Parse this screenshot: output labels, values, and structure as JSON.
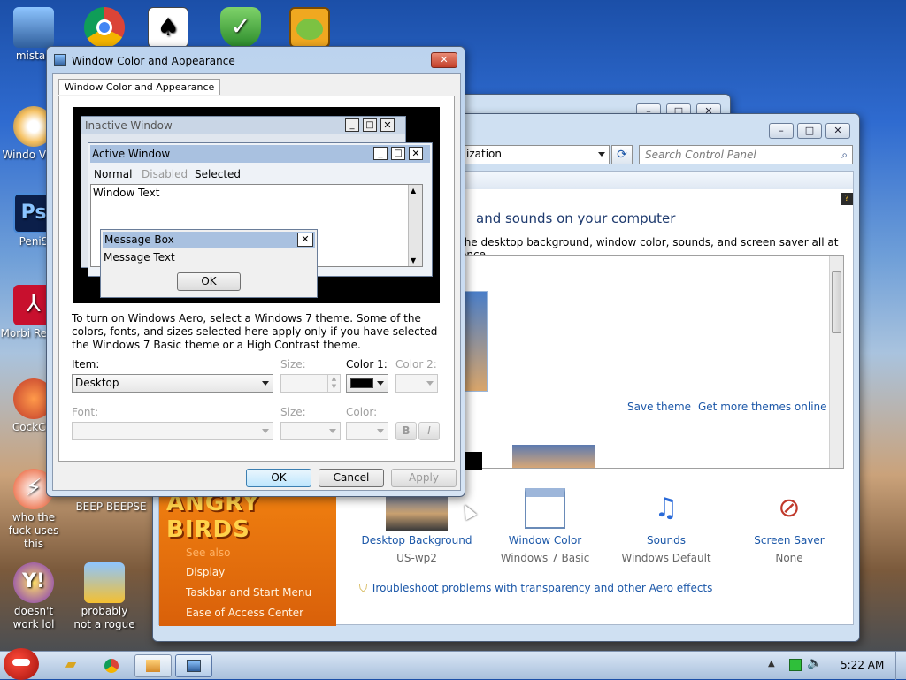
{
  "desktop": {
    "icons": [
      {
        "label": "mistak"
      },
      {
        "label": ""
      },
      {
        "label": ""
      },
      {
        "label": ""
      },
      {
        "label": ""
      },
      {
        "label": "Windo Vista"
      },
      {
        "label": "PeniS"
      },
      {
        "label": "Morbi Reade"
      },
      {
        "label": "CockCle"
      },
      {
        "label": "who the fuck uses this"
      },
      {
        "label": "BEEP BEEP"
      },
      {
        "label": "SE"
      },
      {
        "label": "doesn't work lol"
      },
      {
        "label": "probably not a rogue"
      }
    ]
  },
  "control_panel": {
    "address": "ization",
    "search_placeholder": "Search Control Panel",
    "heading": "and sounds on your computer",
    "subheading": "the desktop background, window color, sounds, and screen saver all at once.",
    "save_theme": "Save theme",
    "get_more_themes": "Get more themes online",
    "sidebar": {
      "see_also": "See also",
      "items": [
        "Display",
        "Taskbar and Start Menu",
        "Ease of Access Center"
      ]
    },
    "items": [
      {
        "title": "Desktop Background",
        "subtitle": "US-wp2"
      },
      {
        "title": "Window Color",
        "subtitle": "Windows 7 Basic"
      },
      {
        "title": "Sounds",
        "subtitle": "Windows Default"
      },
      {
        "title": "Screen Saver",
        "subtitle": "None"
      }
    ],
    "troubleshoot": "Troubleshoot problems with transparency and other Aero effects"
  },
  "dialog": {
    "title": "Window Color and Appearance",
    "tab": "Window Color and Appearance",
    "preview": {
      "inactive_window": "Inactive Window",
      "active_window": "Active Window",
      "menu_normal": "Normal",
      "menu_disabled": "Disabled",
      "menu_selected": "Selected",
      "window_text": "Window Text",
      "message_box": "Message Box",
      "message_text": "Message Text",
      "ok": "OK"
    },
    "info": "To turn on Windows Aero, select a Windows 7 theme.  Some of the colors, fonts, and sizes selected here apply only if you have selected the Windows 7 Basic theme or a High Contrast theme.",
    "item_label": "Item:",
    "item_value": "Desktop",
    "size_label": "Size:",
    "color1_label": "Color 1:",
    "color2_label": "Color 2:",
    "font_label": "Font:",
    "font_size_label": "Size:",
    "font_color_label": "Color:",
    "bold": "B",
    "italic": "I",
    "ok": "OK",
    "cancel": "Cancel",
    "apply": "Apply",
    "color1_value": "#000000"
  },
  "taskbar": {
    "clock": "5:22 AM"
  }
}
